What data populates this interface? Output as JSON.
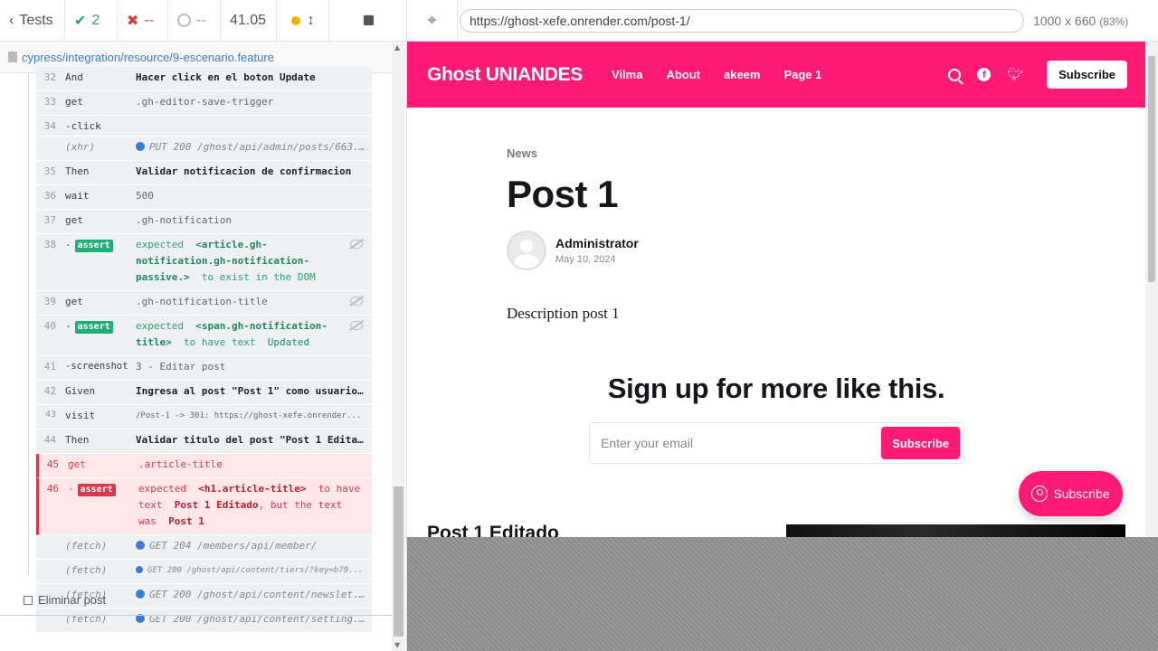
{
  "runner": {
    "tests_label": "Tests",
    "passed": "2",
    "failed": "--",
    "pending": "--",
    "duration": "41.05",
    "spec_path": "cypress/integration/resource/9-escenario.feature"
  },
  "commands": [
    {
      "num": "32",
      "name": "And",
      "msg": "Hacer click en el boton Update"
    },
    {
      "num": "33",
      "name": "get",
      "msg": ".gh-editor-save-trigger"
    },
    {
      "num": "34",
      "name": "-click",
      "msg": ""
    },
    {
      "num": "",
      "name": "(xhr)",
      "msg": "PUT 200 /ghost/api/admin/posts/663..."
    },
    {
      "num": "35",
      "name": "Then",
      "msg": "Validar notificacion de confirmacion"
    },
    {
      "num": "36",
      "name": "wait",
      "msg": "500"
    },
    {
      "num": "37",
      "name": "get",
      "msg": ".gh-notification"
    },
    {
      "num": "38",
      "name": "-",
      "tag": "assert",
      "msg_a": "expected",
      "msg_b": "<article.gh-notification.gh-notification-passive.>",
      "msg_c": "to exist in the DOM"
    },
    {
      "num": "39",
      "name": "get",
      "msg": ".gh-notification-title"
    },
    {
      "num": "40",
      "name": "-",
      "tag": "assert",
      "msg_a": "expected",
      "msg_b": "<span.gh-notification-title>",
      "msg_c": "to have text",
      "msg_d": "Updated"
    },
    {
      "num": "41",
      "name": "-screenshot",
      "msg": "3 - Editar post"
    },
    {
      "num": "42",
      "name": "Given",
      "msg": "Ingresa al post \"Post 1\" como usuario..."
    },
    {
      "num": "43",
      "name": "visit",
      "msg": "/Post-1 -> 301: https://ghost-xefe.onrender..."
    },
    {
      "num": "44",
      "name": "Then",
      "msg": "Validar titulo del post \"Post 1 Edita..."
    },
    {
      "num": "45",
      "name": "get",
      "msg": ".article-title"
    },
    {
      "num": "46",
      "name": "-",
      "tag": "assert",
      "msg_a": "expected",
      "msg_b": "<h1.article-title>",
      "msg_c": "to have text",
      "msg_d": "Post 1 Editado",
      "msg_e": ", but the text was",
      "msg_f": "Post 1"
    },
    {
      "num": "",
      "name": "(fetch)",
      "msg": "GET 204 /members/api/member/"
    },
    {
      "num": "",
      "name": "(fetch)",
      "msg": "GET 200 /ghost/api/content/tiers/?key=b79..."
    },
    {
      "num": "",
      "name": "(fetch)",
      "msg": "GET 200 /ghost/api/content/newslet..."
    },
    {
      "num": "",
      "name": "(fetch)",
      "msg": "GET 200 /ghost/api/content/setting..."
    }
  ],
  "suite_label": "Eliminar post",
  "browser": {
    "url": "https://ghost-xefe.onrender.com/post-1/",
    "viewport": "1000 x 660",
    "zoom": "(83%)"
  },
  "site": {
    "brand": "Ghost UNIANDES",
    "nav": [
      "Vilma",
      "About",
      "akeem",
      "Page 1"
    ],
    "subscribe": "Subscribe",
    "accent": "#ff1a75",
    "tag": "News",
    "title": "Post 1",
    "author": "Administrator",
    "date": "May 10, 2024",
    "description": "Description post 1",
    "cta_title": "Sign up for more like this.",
    "email_placeholder": "Enter your email",
    "cta_button": "Subscribe",
    "portal_button": "Subscribe",
    "related_title": "Post 1 Editado"
  }
}
